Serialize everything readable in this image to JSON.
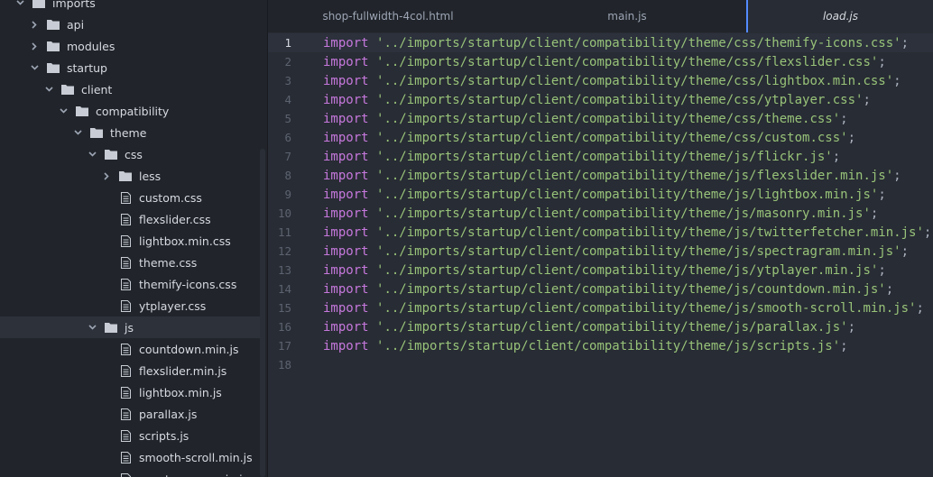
{
  "sidebar": {
    "items": [
      {
        "label": "imports",
        "kind": "folder",
        "state": "open",
        "indent": 0
      },
      {
        "label": "api",
        "kind": "folder",
        "state": "closed",
        "indent": 1
      },
      {
        "label": "modules",
        "kind": "folder",
        "state": "closed",
        "indent": 1
      },
      {
        "label": "startup",
        "kind": "folder",
        "state": "open",
        "indent": 1
      },
      {
        "label": "client",
        "kind": "folder",
        "state": "open",
        "indent": 2
      },
      {
        "label": "compatibility",
        "kind": "folder",
        "state": "open",
        "indent": 3
      },
      {
        "label": "theme",
        "kind": "folder",
        "state": "open",
        "indent": 4
      },
      {
        "label": "css",
        "kind": "folder",
        "state": "open",
        "indent": 5
      },
      {
        "label": "less",
        "kind": "folder",
        "state": "closed",
        "indent": 6
      },
      {
        "label": "custom.css",
        "kind": "file",
        "indent": 6
      },
      {
        "label": "flexslider.css",
        "kind": "file",
        "indent": 6
      },
      {
        "label": "lightbox.min.css",
        "kind": "file",
        "indent": 6
      },
      {
        "label": "theme.css",
        "kind": "file",
        "indent": 6
      },
      {
        "label": "themify-icons.css",
        "kind": "file",
        "indent": 6
      },
      {
        "label": "ytplayer.css",
        "kind": "file",
        "indent": 6
      },
      {
        "label": "js",
        "kind": "folder",
        "state": "open",
        "indent": 5,
        "selected": true
      },
      {
        "label": "countdown.min.js",
        "kind": "file",
        "indent": 6
      },
      {
        "label": "flexslider.min.js",
        "kind": "file",
        "indent": 6
      },
      {
        "label": "lightbox.min.js",
        "kind": "file",
        "indent": 6
      },
      {
        "label": "parallax.js",
        "kind": "file",
        "indent": 6
      },
      {
        "label": "scripts.js",
        "kind": "file",
        "indent": 6
      },
      {
        "label": "smooth-scroll.min.js",
        "kind": "file",
        "indent": 6
      },
      {
        "label": "spectragram.min.js",
        "kind": "file",
        "indent": 6
      }
    ]
  },
  "tabs": [
    {
      "label": "shop-fullwidth-4col.html",
      "active": false
    },
    {
      "label": "main.js",
      "active": false
    },
    {
      "label": "load.js",
      "active": true
    }
  ],
  "editor": {
    "current_line": 1,
    "keyword": "import",
    "lines": [
      "'../imports/startup/client/compatibility/theme/css/themify-icons.css'",
      "'../imports/startup/client/compatibility/theme/css/flexslider.css'",
      "'../imports/startup/client/compatibility/theme/css/lightbox.min.css'",
      "'../imports/startup/client/compatibility/theme/css/ytplayer.css'",
      "'../imports/startup/client/compatibility/theme/css/theme.css'",
      "'../imports/startup/client/compatibility/theme/css/custom.css'",
      "'../imports/startup/client/compatibility/theme/js/flickr.js'",
      "'../imports/startup/client/compatibility/theme/js/flexslider.min.js'",
      "'../imports/startup/client/compatibility/theme/js/lightbox.min.js'",
      "'../imports/startup/client/compatibility/theme/js/masonry.min.js'",
      "'../imports/startup/client/compatibility/theme/js/twitterfetcher.min.js'",
      "'../imports/startup/client/compatibility/theme/js/spectragram.min.js'",
      "'../imports/startup/client/compatibility/theme/js/ytplayer.min.js'",
      "'../imports/startup/client/compatibility/theme/js/countdown.min.js'",
      "'../imports/startup/client/compatibility/theme/js/smooth-scroll.min.js'",
      "'../imports/startup/client/compatibility/theme/js/parallax.js'",
      "'../imports/startup/client/compatibility/theme/js/scripts.js'",
      ""
    ]
  },
  "colors": {
    "keyword": "#c678dd",
    "string": "#98c379",
    "accent": "#528bff"
  }
}
